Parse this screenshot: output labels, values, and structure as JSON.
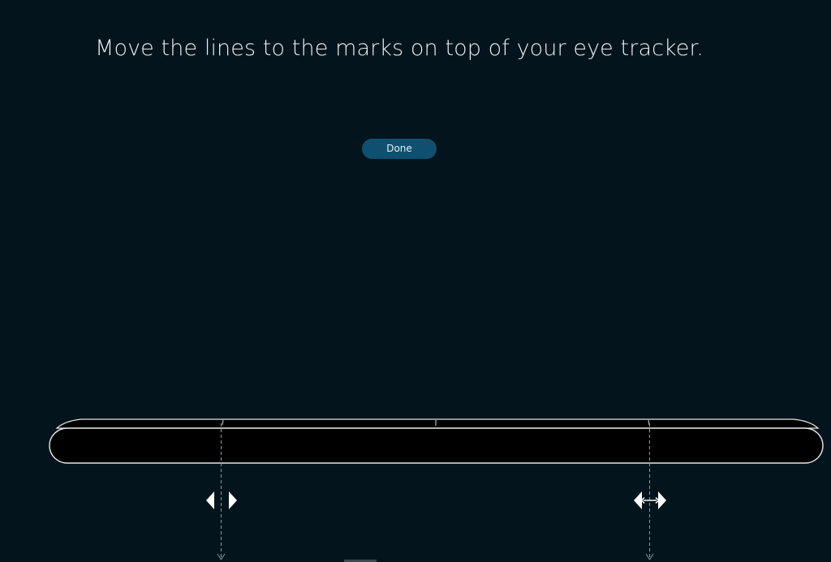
{
  "instruction": {
    "text": "Move the lines to the marks on top of your eye tracker."
  },
  "done_button": {
    "label": "Done"
  },
  "icons": {
    "left_handle": "left-right-arrows-icon",
    "right_handle": "resize-horizontal-arrows-icon",
    "guide_arrow": "chevron-down-icon"
  },
  "colors": {
    "background": "#03141c",
    "button": "#0f5070",
    "tracker_body": "#000000",
    "tracker_outline": "#e6e6e6",
    "guide_line": "#8a9aa2"
  }
}
